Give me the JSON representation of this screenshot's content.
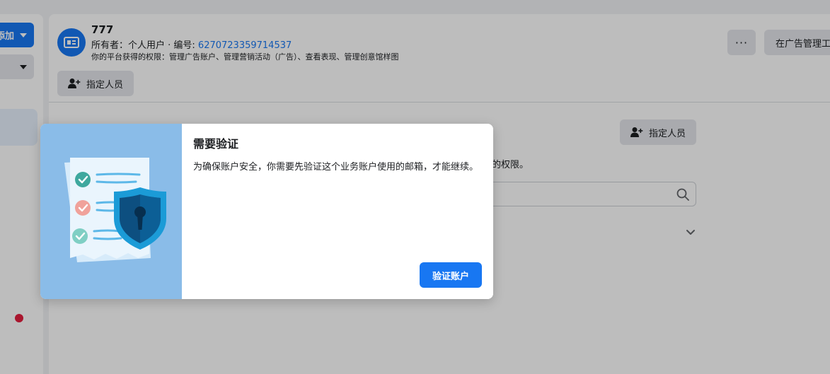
{
  "sidebar": {
    "add_button_label": "添加"
  },
  "account": {
    "name": "777",
    "owner_prefix": "所有者：个人用户 · 编号: ",
    "id_number": "6270723359714537",
    "permissions_text": "你的平台获得的权限：管理广告账户、管理营销活动（广告）、查看表现、管理创意馆样图"
  },
  "toolbar": {
    "assign_people_label": "指定人员",
    "more_label": "···",
    "open_in_ads_manager_label": "在广告管理工"
  },
  "content": {
    "assign_people_label": "指定人员",
    "permissions_tail": "的权限。"
  },
  "modal": {
    "title": "需要验证",
    "message": "为确保账户安全，你需要先验证这个业务账户使用的邮箱，才能继续。",
    "verify_button_label": "验证账户"
  },
  "colors": {
    "accent": "#1877f2",
    "illustration_bg": "#8abce8",
    "notification_dot": "#e41e3f"
  }
}
